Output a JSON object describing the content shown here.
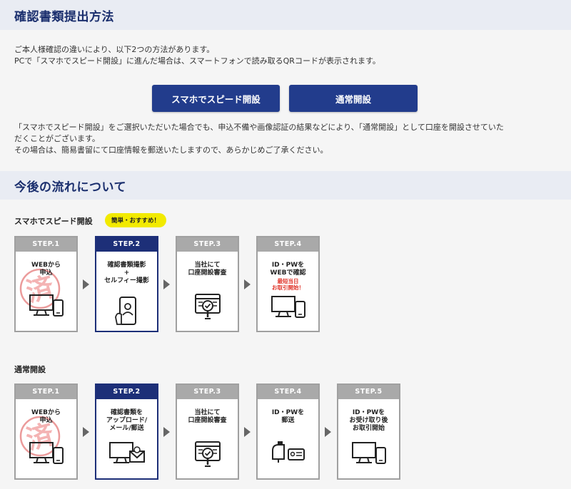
{
  "section1": {
    "title": "確認書類提出方法",
    "intro_line1": "ご本人様確認の違いにより、以下2つの方法があります。",
    "intro_line2": "PCで「スマホでスピード開設」に進んだ場合は、スマートフォンで読み取るQRコードが表示されます。",
    "buttons": {
      "speed": "スマホでスピード開設",
      "normal": "通常開設"
    },
    "note_line1": "「スマホでスピード開設」をご選択いただいた場合でも、申込不備や画像認証の結果などにより、「通常開設」として口座を開設させていた",
    "note_line2": "だくことがございます。",
    "note_line3": "その場合は、簡易書留にて口座情報を郵送いたしますので、あらかじめご了承ください。"
  },
  "section2": {
    "title": "今後の流れについて"
  },
  "flow1": {
    "label": "スマホでスピード開設",
    "badge": "簡単・おすすめ！",
    "steps": [
      {
        "head": "STEP.1",
        "text": "WEBから\n申込",
        "icon": "desktop-and-phone-icon",
        "stamp": "済"
      },
      {
        "head": "STEP.2",
        "text": "確認書類撮影\n+\nセルフィー撮影",
        "icon": "smartphone-selfie-icon"
      },
      {
        "head": "STEP.3",
        "text": "当社にて\n口座開設審査",
        "icon": "document-review-icon"
      },
      {
        "head": "STEP.4",
        "text": "ID・PWを\nWEBで確認",
        "red": "最短当日\nお取引開始！",
        "icon": "desktop-and-phone-icon"
      }
    ]
  },
  "flow2": {
    "label": "通常開設",
    "steps": [
      {
        "head": "STEP.1",
        "text": "WEBから\n申込",
        "icon": "desktop-and-phone-icon",
        "stamp": "済"
      },
      {
        "head": "STEP.2",
        "text": "確認書類を\nアップロード/\nメール/郵送",
        "icon": "desktop-and-mail-icon"
      },
      {
        "head": "STEP.3",
        "text": "当社にて\n口座開設審査",
        "icon": "document-review-icon"
      },
      {
        "head": "STEP.4",
        "text": "ID・PWを\n郵送",
        "icon": "mailbox-and-card-icon"
      },
      {
        "head": "STEP.5",
        "text": "ID・PWを\nお受け取り後\nお取引開始",
        "icon": "desktop-and-phone-icon"
      }
    ]
  },
  "colors": {
    "navy": "#1d2f78",
    "button": "#223c8c",
    "badge": "#f2ea00",
    "stamp": "#e88a8a",
    "red_text": "#e0352a",
    "inactive": "#a9a9a9"
  }
}
